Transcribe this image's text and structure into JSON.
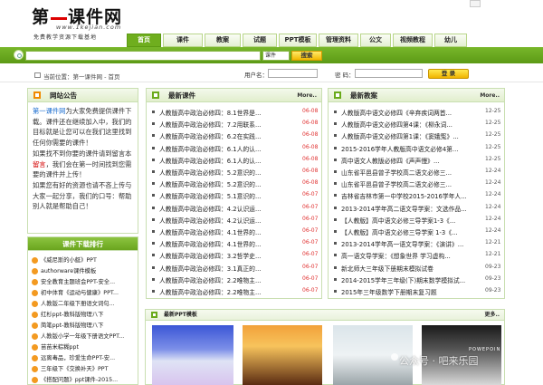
{
  "logo": {
    "title_a": "第",
    "title_b": "课件网",
    "url": "www.1kejian.com",
    "slogan": "免费教学资源下载基地"
  },
  "nav": [
    "首页",
    "课件",
    "教案",
    "试题",
    "PPT模板",
    "管理资料",
    "公文",
    "视频教程",
    "幼儿"
  ],
  "search": {
    "select": "课件",
    "button": "搜索"
  },
  "location": {
    "text": "当前位置：第一课件网 - 首页"
  },
  "login": {
    "user_label": "用户名：",
    "pw_label": "密  码：",
    "button": "登  录"
  },
  "notice": {
    "title": "网站公告",
    "p1": "第一课件网",
    "p2": "为大家免费提供课件下载。课件还在继续加入中，我们的目标就是让您可以在我们这里找到任何你需要的课件！",
    "p3": "如果找不到你要的课件请到留言本",
    "p4": "留言",
    "p5": "，我们会在第一时间找到您需要的课件并上传！",
    "p6": "如果您有好的资源也请不吝上传与大家一起分享，我们的口号：帮助别人就是帮助自己！"
  },
  "dl_rank": {
    "title": "课件下载排行",
    "items": [
      "《威尼斯的小艇》PPT",
      "authorware课件模板",
      "安全教育主题班会PPT-安全...",
      "初中体育《运动与健康》PPT...",
      "人教版二年级下册语文词句...",
      "红杉ppt-教科版物理八下",
      "简笔ppt-教科版物理八下",
      "人教版小学一年级下册语文PPT...",
      "苗苗米粽糊ppt",
      "远离毒品，珍爱生命PPT-安...",
      "三年级下《交换补天》PPT",
      "《搭配问题》ppt课件-2015..."
    ]
  },
  "latest_courses": {
    "title": "最新课件",
    "more": "More..",
    "rows": [
      {
        "t": "人教版高中政治必修四：8.1世界是...",
        "d": "06-08"
      },
      {
        "t": "人教版高中政治必修四：7.2用联系...",
        "d": "06-08"
      },
      {
        "t": "人教版高中政治必修四：6.2在实践...",
        "d": "06-08"
      },
      {
        "t": "人教版高中政治必修四：6.1人的认...",
        "d": "06-08"
      },
      {
        "t": "人教版高中政治必修四：6.1人的认...",
        "d": "06-08"
      },
      {
        "t": "人教版高中政治必修四：5.2意识的...",
        "d": "06-08"
      },
      {
        "t": "人教版高中政治必修四：5.2意识的...",
        "d": "06-08"
      },
      {
        "t": "人教版高中政治必修四：5.1意识的...",
        "d": "06-07"
      },
      {
        "t": "人教版高中政治必修四：4.2认识运...",
        "d": "06-07"
      },
      {
        "t": "人教版高中政治必修四：4.2认识运...",
        "d": "06-07"
      },
      {
        "t": "人教版高中政治必修四：4.1世界的...",
        "d": "06-07"
      },
      {
        "t": "人教版高中政治必修四：4.1世界的...",
        "d": "06-07"
      },
      {
        "t": "人教版高中政治必修四：3.2哲学史...",
        "d": "06-07"
      },
      {
        "t": "人教版高中政治必修四：3.1真正的...",
        "d": "06-07"
      },
      {
        "t": "人教版高中政治必修四：2.2唯物主...",
        "d": "06-07"
      },
      {
        "t": "人教版高中政治必修四：2.2唯物主...",
        "d": "06-07"
      }
    ]
  },
  "latest_lessons": {
    "title": "最新教案",
    "more": "More..",
    "rows": [
      {
        "t": "人教版高中语文必修四《辛弃疾词两首...",
        "d": "12-25"
      },
      {
        "t": "人教版高中语文必修四第4课：《柳永词...",
        "d": "12-25"
      },
      {
        "t": "人教版高中语文必修四第1课：《窦娥冤》...",
        "d": "12-25"
      },
      {
        "t": "2015-2016学年人教版高中语文必修4第...",
        "d": "12-25"
      },
      {
        "t": "高中语文人教版必修四《声声慢》...",
        "d": "12-25"
      },
      {
        "t": "山东省平邑县曾子学校高二语文必修三...",
        "d": "12-24"
      },
      {
        "t": "山东省平邑县曾子学校高二语文必修三...",
        "d": "12-24"
      },
      {
        "t": "吉林省吉林市第一中学校2015-2016学年人...",
        "d": "12-24"
      },
      {
        "t": "2013-2014学年高二语文导学案：文选作品...",
        "d": "12-24"
      },
      {
        "t": "【人教版】高中语文必修三导学案1-3《...",
        "d": "12-24"
      },
      {
        "t": "【人教版】高中语文必修三导学案 1-3《...",
        "d": "12-24"
      },
      {
        "t": "2013-2014学年高一语文导学案：《演讲》...",
        "d": "12-21"
      },
      {
        "t": "高一语文导学案：《想象世界 学习虚构...",
        "d": "12-21"
      },
      {
        "t": "新北师大三年级下册期末模拟试卷",
        "d": "09-23"
      },
      {
        "t": "2014-2015学年三年级(下)期末数学模拟试...",
        "d": "09-23"
      },
      {
        "t": "2015年三年级数学下册期末复习题",
        "d": "09-23"
      }
    ]
  },
  "ppt": {
    "title": "最新PPT模板",
    "more": "更多..",
    "t1_caption": "",
    "t4_caption": "POWEPOIN"
  },
  "watermark": "公众号 · 吧来乐园",
  "colors": {
    "brand_green": "#6fae1e",
    "date_red": "#e03030",
    "accent_orange": "#f39a21"
  }
}
